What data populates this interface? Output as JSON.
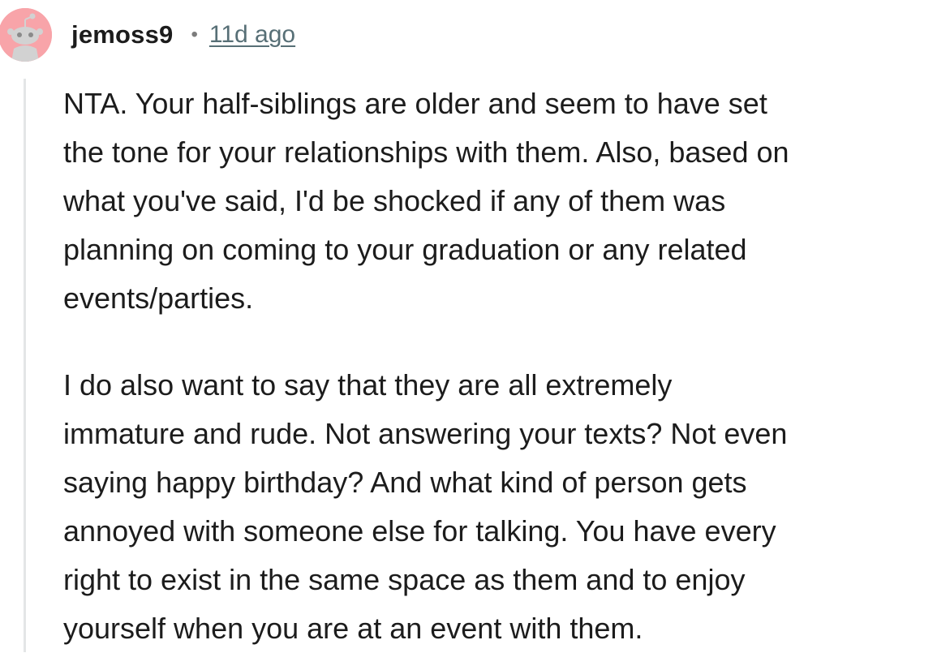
{
  "comment": {
    "author": "jemoss9",
    "separator": "•",
    "timestamp": "11d ago",
    "avatar_icon": "reddit-snoo-avatar-icon",
    "colors": {
      "avatar_bg": "#f8a4a9",
      "timestamp": "#576f76",
      "thread_line": "#e4e6e7"
    },
    "paragraphs": [
      "NTA. Your half-siblings are older and seem to have set\nthe tone for your relationships with them. Also, based on\nwhat you've said, I'd be shocked if any of them was\nplanning on coming to your graduation or any related\nevents/parties.",
      "I do also want to say that they are all extremely\nimmature and rude. Not answering your texts? Not even\nsaying happy birthday? And what kind of person gets\nannoyed with someone else for talking. You have every\nright to exist in the same space as them and to enjoy\nyourself when you are at an event with them."
    ]
  }
}
